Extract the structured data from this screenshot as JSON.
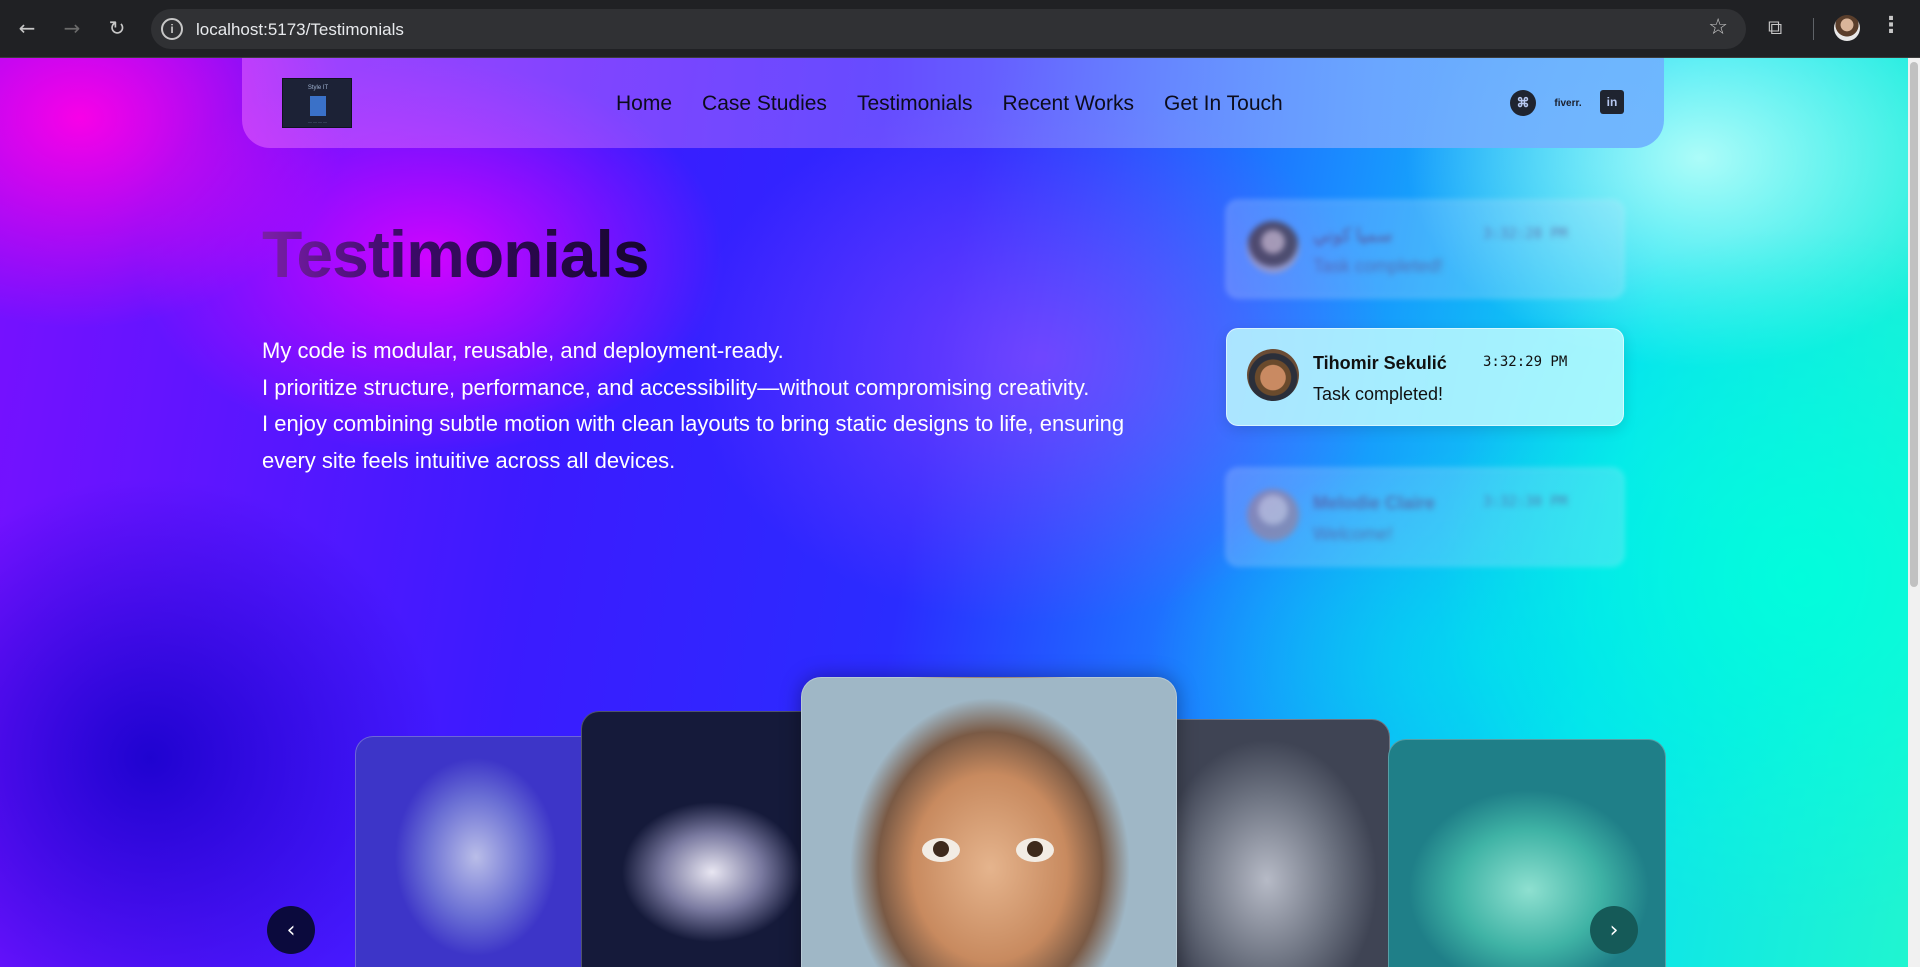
{
  "browser": {
    "url": "localhost:5173/Testimonials",
    "back_icon": "arrow-left-icon",
    "forward_icon": "arrow-right-icon",
    "reload_icon": "reload-icon",
    "site_info_icon": "info-icon",
    "bookmark_icon": "star-icon",
    "extensions_icon": "puzzle-icon",
    "menu_icon": "kebab-menu-icon"
  },
  "header": {
    "logo_text": "Style IT",
    "nav": [
      "Home",
      "Case Studies",
      "Testimonials",
      "Recent Works",
      "Get In Touch"
    ],
    "fiverr_label": "fiverr.",
    "social_icons": [
      "github-icon",
      "fiverr-icon",
      "linkedin-icon"
    ]
  },
  "page": {
    "title": "Testimonials",
    "intro_lines": [
      "My code is modular, reusable, and deployment-ready.",
      "I prioritize structure, performance, and accessibility—without compromising creativity.",
      "I enjoy combining subtle motion with clean layouts to bring static designs to life, ensuring every site feels intuitive across all devices."
    ]
  },
  "notifications": [
    {
      "name": "سميا كوني",
      "time": "3:32:28 PM",
      "message": "Task completed!",
      "state": "blurred"
    },
    {
      "name": "Tihomir Sekulić",
      "time": "3:32:29 PM",
      "message": "Task completed!",
      "state": "active"
    },
    {
      "name": "Melodie Claire",
      "time": "3:32:30 PM",
      "message": "Welcome!",
      "state": "blurred"
    }
  ],
  "carousel": {
    "prev_icon": "chevron-left-icon",
    "next_icon": "chevron-right-icon",
    "cards": [
      "einstein-portrait-1",
      "einstein-portrait-2",
      "einstein-portrait-3",
      "einstein-portrait-4",
      "einstein-portrait-5"
    ]
  }
}
